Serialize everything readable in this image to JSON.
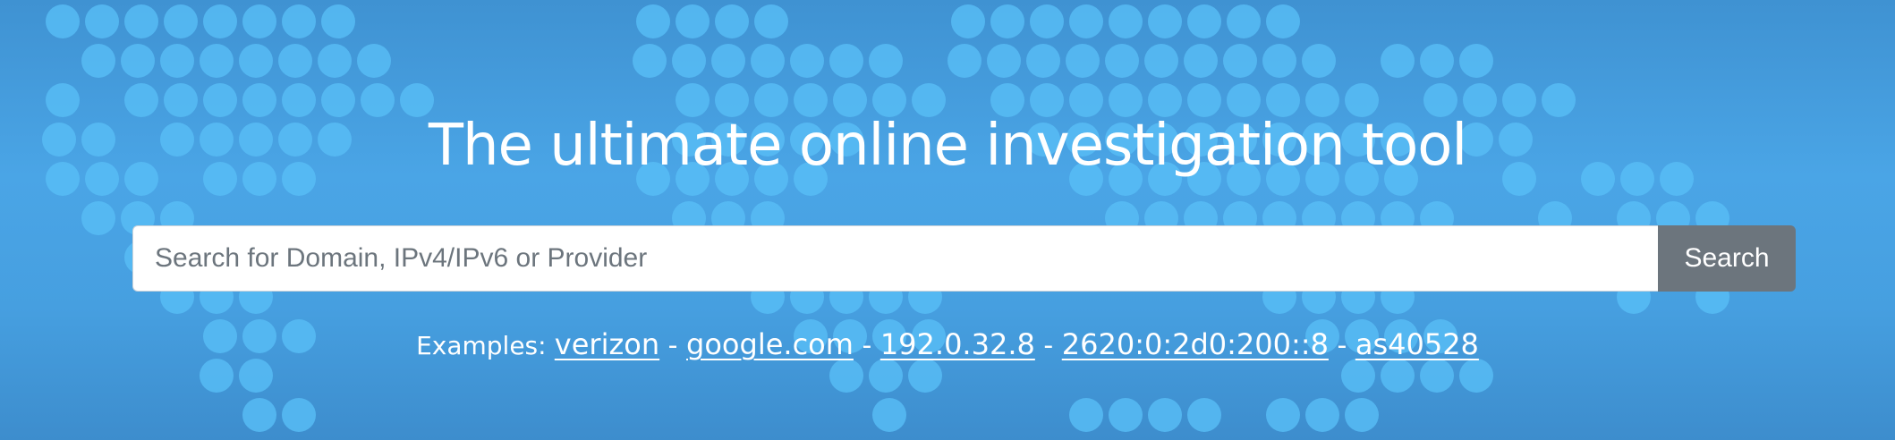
{
  "hero": {
    "title": "The ultimate online investigation tool",
    "background_color": "#4aa5e6",
    "dot_color": "#58bdf5"
  },
  "search": {
    "placeholder": "Search for Domain, IPv4/IPv6 or Provider",
    "value": "",
    "button_label": "Search",
    "button_color": "#6c757d"
  },
  "examples": {
    "label": "Examples:",
    "separator": " - ",
    "links": [
      {
        "text": "verizon"
      },
      {
        "text": "google.com"
      },
      {
        "text": "192.0.32.8"
      },
      {
        "text": "2620:0:2d0:200::8"
      },
      {
        "text": "as40528"
      }
    ]
  }
}
